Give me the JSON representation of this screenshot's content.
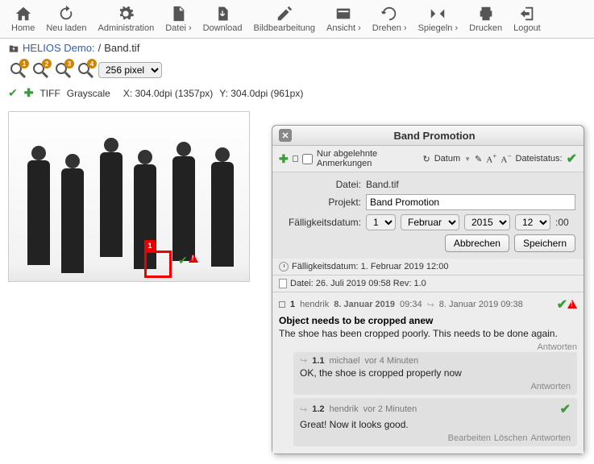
{
  "toolbar": {
    "home": "Home",
    "reload": "Neu laden",
    "admin": "Administration",
    "file": "Datei ›",
    "download": "Download",
    "imgedit": "Bildbearbeitung",
    "view": "Ansicht ›",
    "rotate": "Drehen ›",
    "mirror": "Spiegeln ›",
    "print": "Drucken",
    "logout": "Logout"
  },
  "breadcrumb": {
    "root": "HELIOS Demo:",
    "sep": "/",
    "file": "Band.tif"
  },
  "zoom": {
    "b1": "1",
    "b2": "2",
    "b3": "3",
    "b4": "4",
    "select": "256 pixel"
  },
  "info": {
    "format": "TIFF",
    "color": "Grayscale",
    "x": "X:  304.0dpi (1357px)",
    "y": "Y:  304.0dpi (961px)"
  },
  "anno_marker": "1",
  "panel": {
    "title": "Band Promotion",
    "filter_label": "Nur abgelehnte Anmerkungen",
    "sort": "Datum",
    "filestatus_label": "Dateistatus:",
    "form": {
      "file_label": "Datei:",
      "file_value": "Band.tif",
      "project_label": "Projekt:",
      "project_value": "Band Promotion",
      "due_label": "Fälligkeitsdatum:",
      "day": "1",
      "month": "Februar",
      "year": "2015",
      "hour": "12",
      "minsuffix": ":00",
      "cancel": "Abbrechen",
      "save": "Speichern"
    },
    "meta_due": "Fälligkeitsdatum: 1. Februar 2019 12:00",
    "meta_file": "Datei: 26. Juli 2019 09:58 Rev: 1.0",
    "comment": {
      "num": "1",
      "user": "hendrik",
      "date1": "8. Januar 2019",
      "time1": "09:34",
      "date2": "8. Januar 2019 09:38",
      "title_text": "Object needs to be cropped anew",
      "body_text": "The shoe has been cropped poorly. This needs to be done again.",
      "reply_label": "Antworten",
      "r1": {
        "num": "1.1",
        "user": "michael",
        "time": "vor 4 Minuten",
        "body": "OK, the shoe is cropped properly now"
      },
      "r2": {
        "num": "1.2",
        "user": "hendrik",
        "time": "vor 2 Minuten",
        "body": "Great! Now it looks good."
      },
      "edit": "Bearbeiten",
      "delete": "Löschen"
    }
  }
}
